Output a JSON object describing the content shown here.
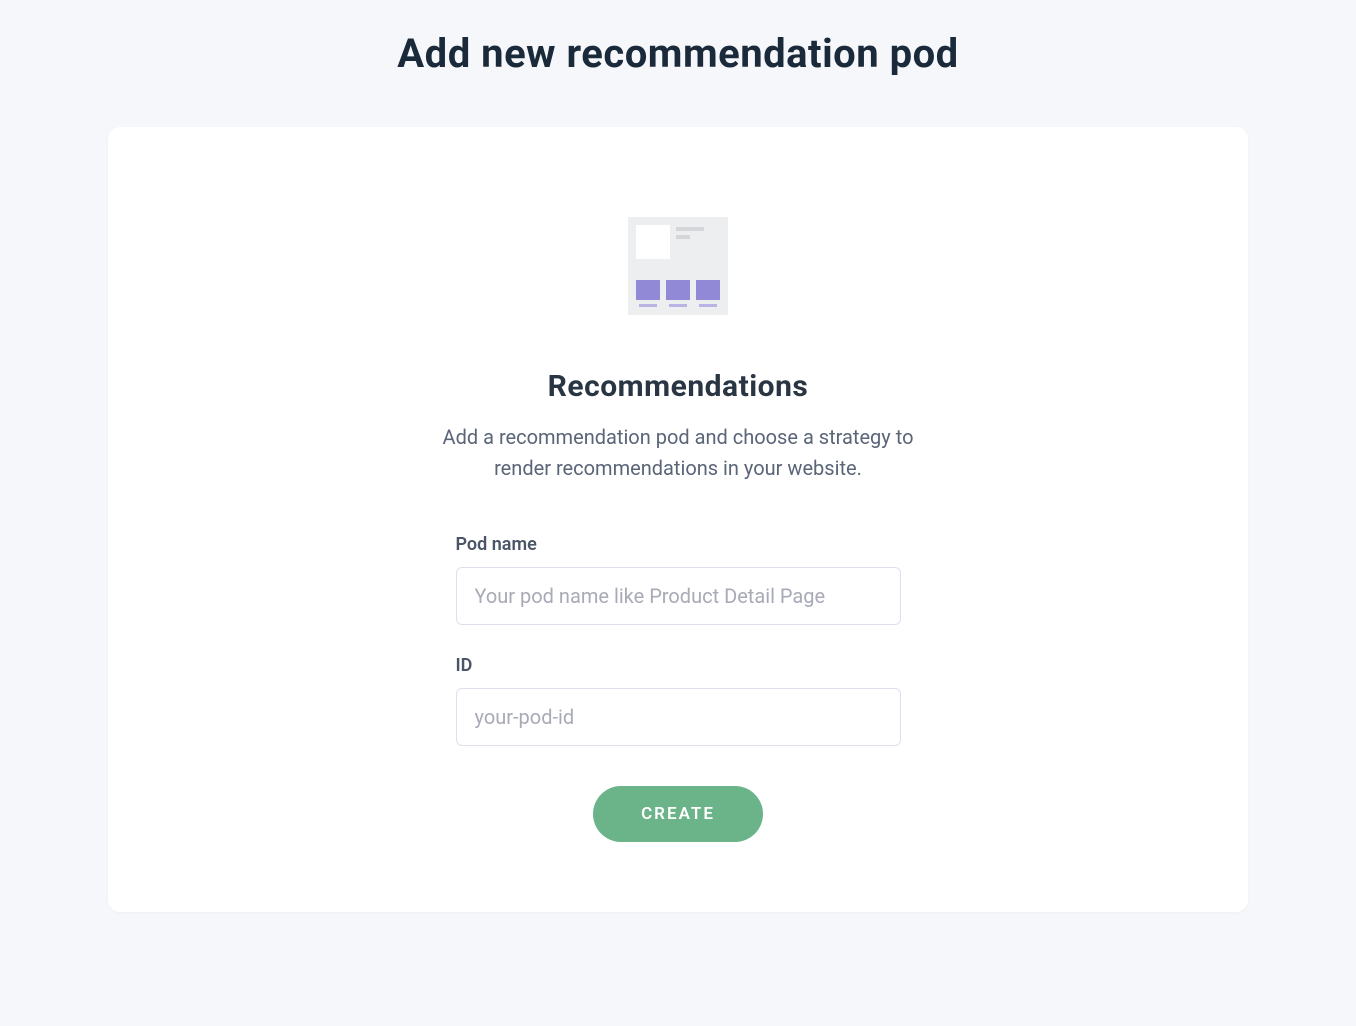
{
  "page": {
    "title": "Add new recommendation pod"
  },
  "card": {
    "heading": "Recommendations",
    "description": "Add a recommendation pod and choose a strategy to render recommendations in your website."
  },
  "form": {
    "pod_name": {
      "label": "Pod name",
      "placeholder": "Your pod name like Product Detail Page",
      "value": ""
    },
    "id": {
      "label": "ID",
      "placeholder": "your-pod-id",
      "value": ""
    },
    "submit_label": "CREATE"
  }
}
